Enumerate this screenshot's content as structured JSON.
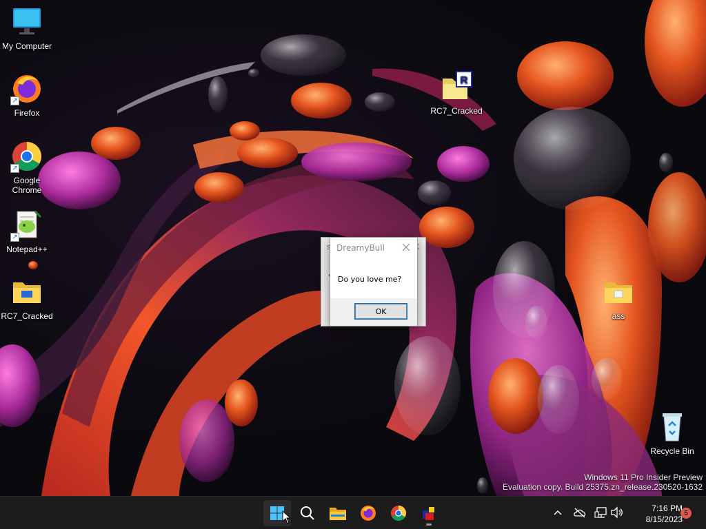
{
  "desktop": {
    "icons": [
      {
        "label": "My Computer",
        "icon": "monitor-icon"
      },
      {
        "label": "Firefox",
        "icon": "firefox-icon"
      },
      {
        "label": "Google Chrome",
        "icon": "chrome-icon"
      },
      {
        "label": "Notepad++",
        "icon": "notepadpp-icon"
      },
      {
        "label": "RC7_Cracked",
        "icon": "folder-icon"
      },
      {
        "label": "RC7_Cracked",
        "icon": "rc7-app-icon"
      },
      {
        "label": "ass",
        "icon": "folder-icon"
      },
      {
        "label": "Recycle Bin",
        "icon": "recycle-bin-icon"
      }
    ],
    "watermark": {
      "line1": "Windows 11 Pro Insider Preview",
      "line2": "Evaluation copy. Build 25375.zn_release.230520-1632"
    }
  },
  "dialog": {
    "title": "DreamyBull",
    "message": "Do you love me?",
    "ok_label": "OK",
    "back_title_fragment": "s",
    "back_body_fragment": "Y"
  },
  "taskbar": {
    "apps": [
      "start-icon",
      "search-icon",
      "file-explorer-icon",
      "firefox-icon",
      "chrome-icon",
      "rc7-app-icon"
    ],
    "tray": [
      "chevron-up-icon",
      "onedrive-offline-icon",
      "network-icon",
      "volume-icon"
    ],
    "time": "7:16 PM",
    "date": "8/15/2023",
    "notifications": "5"
  },
  "colors": {
    "accent": "#0078d7",
    "taskbar": "#1c1c1c"
  }
}
